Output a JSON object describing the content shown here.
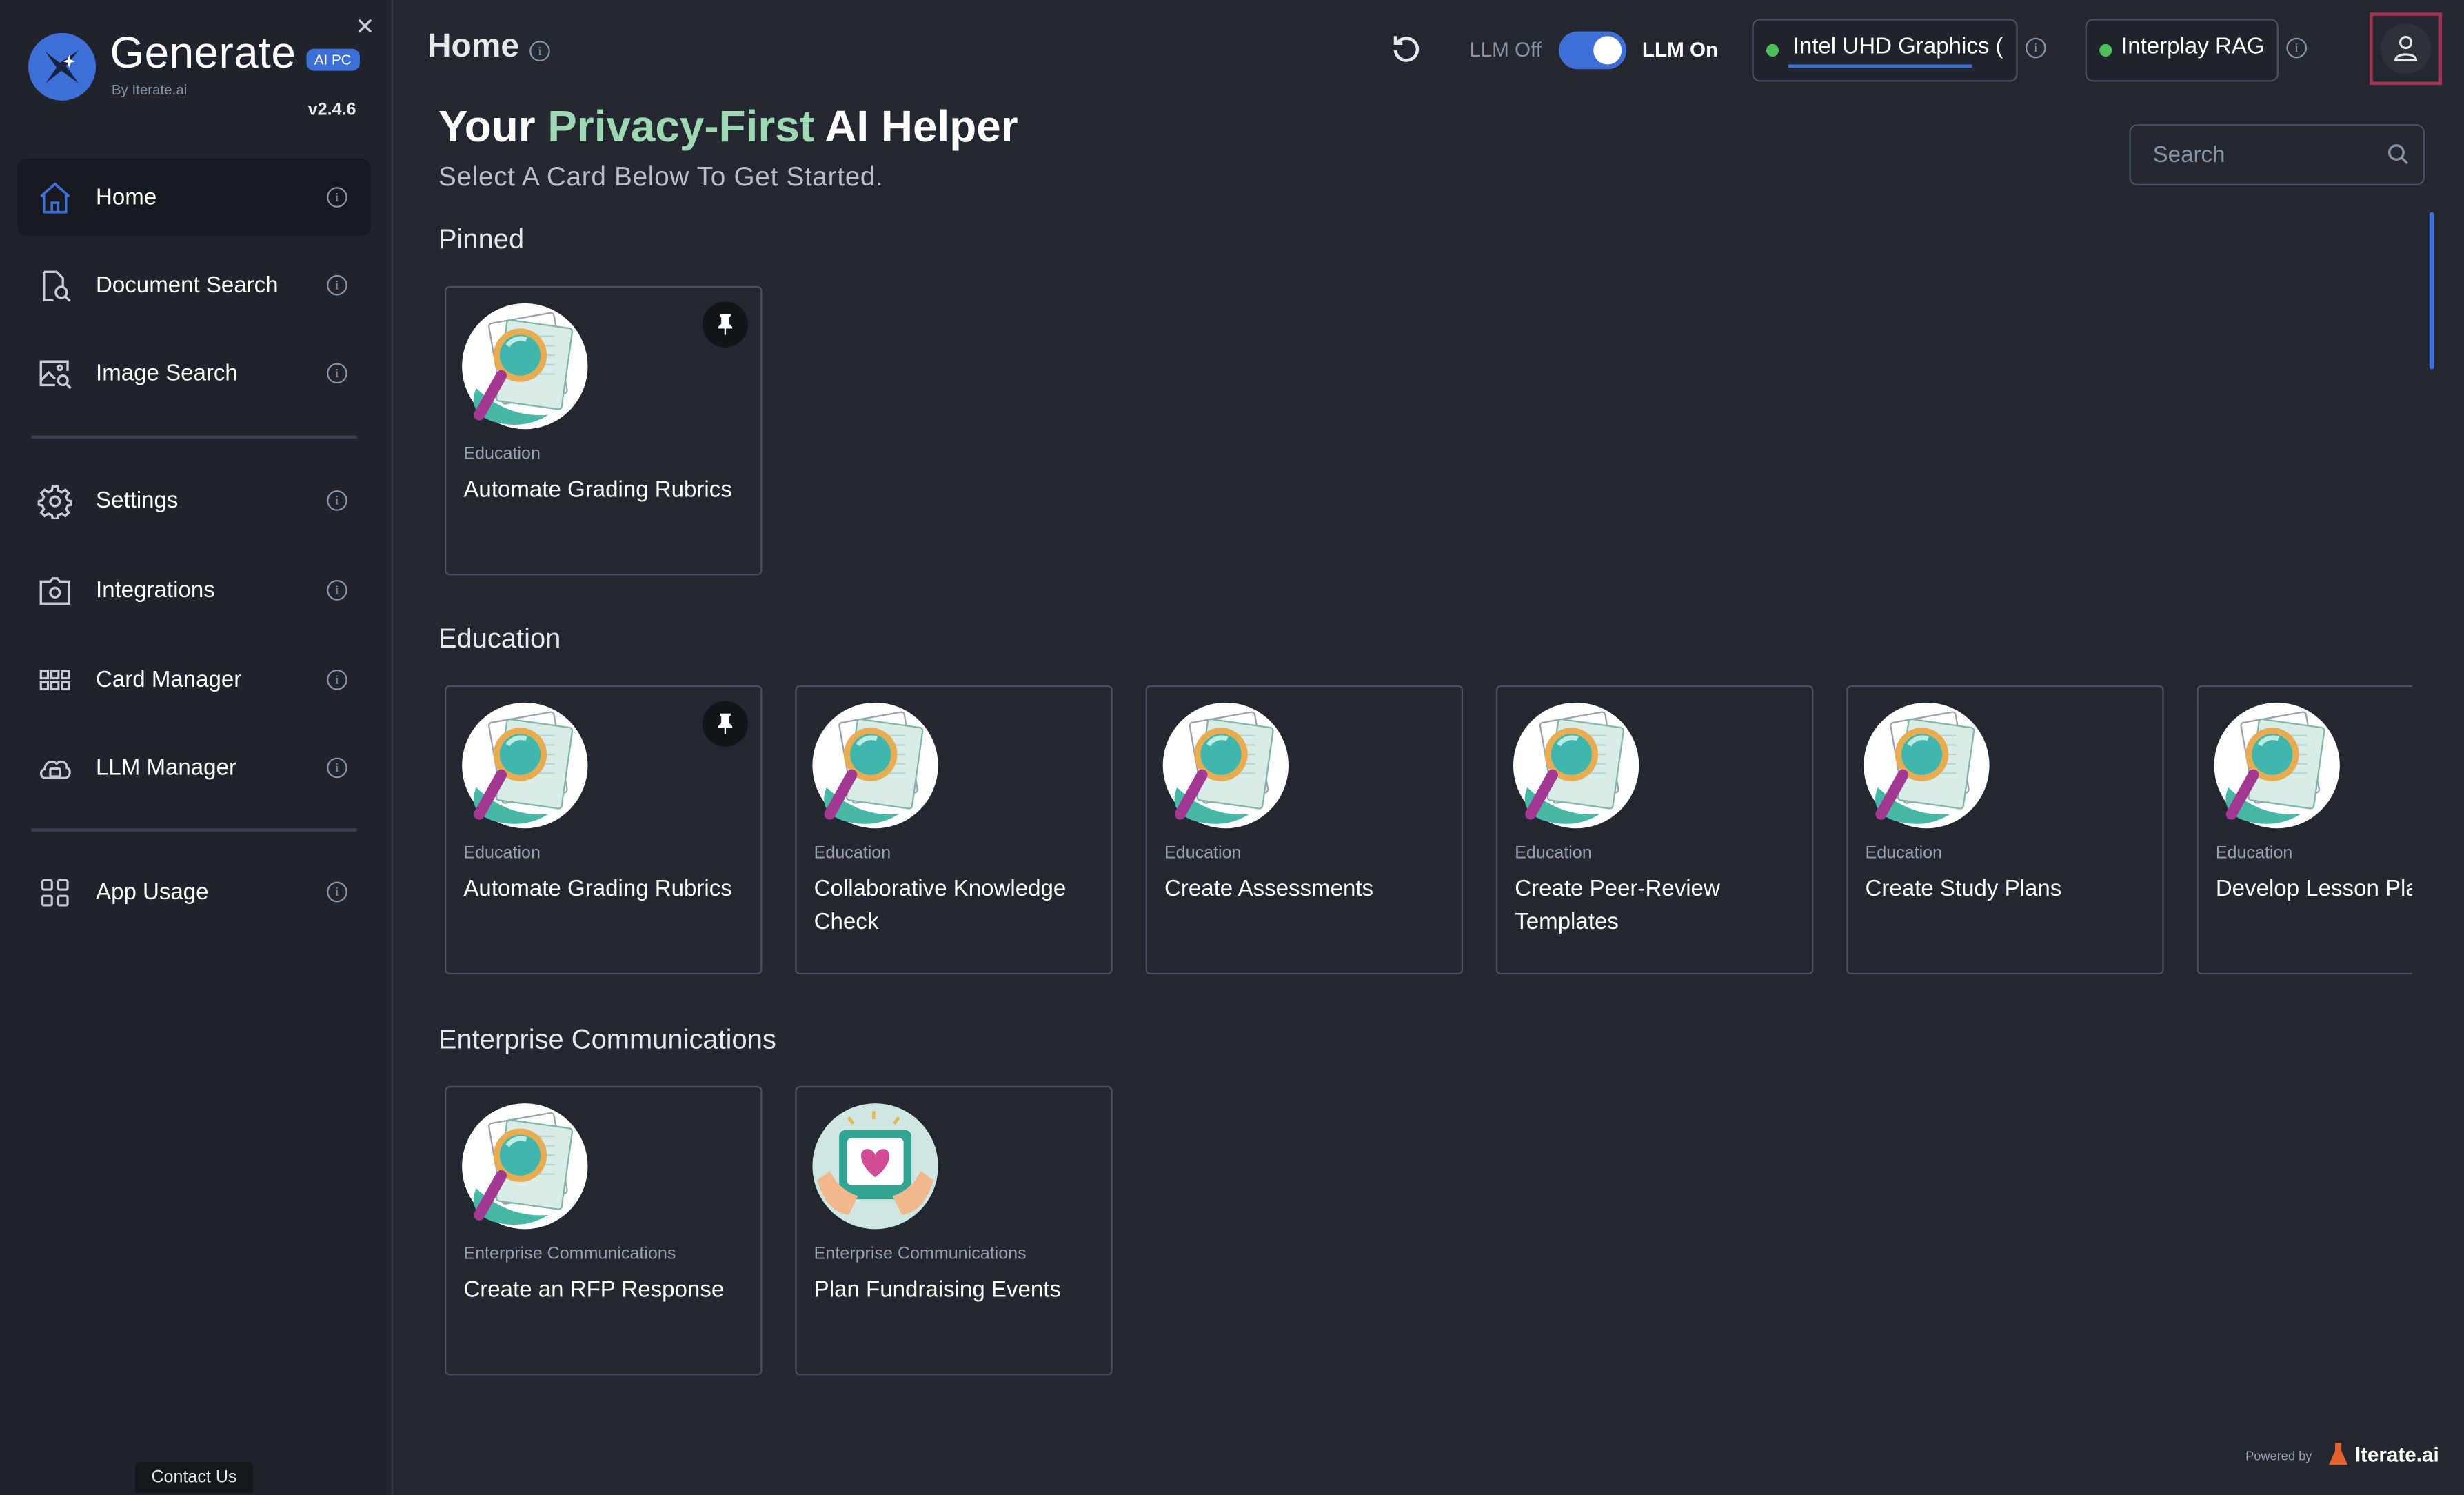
{
  "app": {
    "name": "Generate",
    "badge": "AI PC",
    "by": "By Iterate.ai",
    "version": "v2.4.6"
  },
  "sidebar": {
    "items": [
      {
        "label": "Home",
        "icon": "home-icon",
        "active": true
      },
      {
        "label": "Document Search",
        "icon": "document-search-icon"
      },
      {
        "label": "Image Search",
        "icon": "image-search-icon"
      },
      {
        "label": "Settings",
        "icon": "gear-icon"
      },
      {
        "label": "Integrations",
        "icon": "integrations-icon"
      },
      {
        "label": "Card Manager",
        "icon": "grid-icon"
      },
      {
        "label": "LLM Manager",
        "icon": "cloud-chip-icon"
      },
      {
        "label": "App Usage",
        "icon": "apps-icon"
      }
    ],
    "contact": "Contact Us",
    "close_icon": "close-icon"
  },
  "header": {
    "title": "Home",
    "llm_off": "LLM Off",
    "llm_on": "LLM On",
    "llm_enabled": true,
    "device": "Intel UHD Graphics (",
    "rag": "Interplay RAG",
    "status_color": "#4fbf5c"
  },
  "hero": {
    "title_pre": "Your",
    "title_accent": "Privacy-First",
    "title_post": "AI Helper",
    "subtitle": "Select A Card Below To Get Started."
  },
  "search": {
    "placeholder": "Search",
    "value": ""
  },
  "sections": {
    "pinned": {
      "title": "Pinned",
      "cards": [
        {
          "category": "Education",
          "title": "Automate Grading Rubrics",
          "pinned": true,
          "thumb": "magnifier-icon"
        }
      ]
    },
    "education": {
      "title": "Education",
      "cards": [
        {
          "category": "Education",
          "title": "Automate Grading Rubrics",
          "pinned": true,
          "thumb": "magnifier-icon"
        },
        {
          "category": "Education",
          "title": "Collaborative Knowledge Check",
          "thumb": "magnifier-icon"
        },
        {
          "category": "Education",
          "title": "Create Assessments",
          "thumb": "magnifier-icon"
        },
        {
          "category": "Education",
          "title": "Create Peer-Review Templates",
          "thumb": "magnifier-icon"
        },
        {
          "category": "Education",
          "title": "Create Study Plans",
          "thumb": "magnifier-icon"
        },
        {
          "category": "Education",
          "title": "Develop Lesson Pla",
          "thumb": "magnifier-icon"
        }
      ]
    },
    "enterprise": {
      "title": "Enterprise Communications",
      "cards": [
        {
          "category": "Enterprise Communications",
          "title": "Create an RFP Response",
          "thumb": "magnifier-icon"
        },
        {
          "category": "Enterprise Communications",
          "title": "Plan Fundraising Events",
          "thumb": "heart-gift-icon"
        }
      ]
    }
  },
  "footer": {
    "powered_by": "Powered by",
    "brand": "Iterate.ai"
  },
  "colors": {
    "accent": "#3d6fd6",
    "accent_text": "#9fd9b3",
    "background": "#232730",
    "sidebar": "#1f232b",
    "user_highlight": "#a3344f"
  }
}
